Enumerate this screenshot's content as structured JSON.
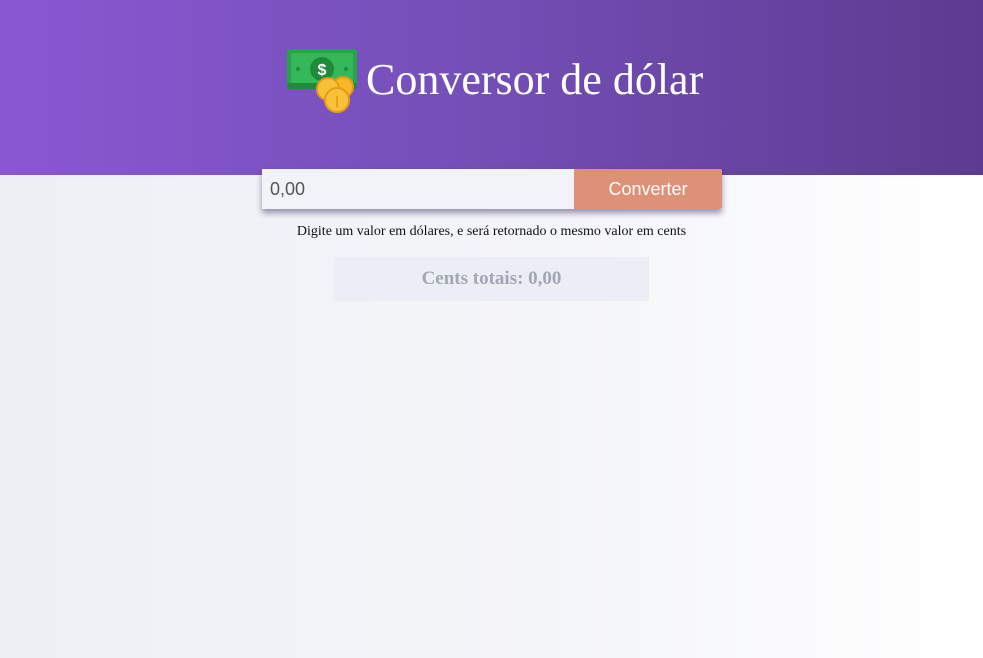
{
  "header": {
    "icon": "money-bill-coins-icon",
    "title": "Conversor de dólar",
    "colors": {
      "gradient_start": "#8a57d2",
      "gradient_end": "#5d3b90"
    }
  },
  "converter": {
    "input_placeholder": "0,00",
    "button_label": "Converter",
    "button_color": "#dd9277"
  },
  "hint": "Digite um valor em dólares, e será retornado o mesmo valor em cents",
  "result": {
    "text": "Cents totais: 0,00"
  }
}
